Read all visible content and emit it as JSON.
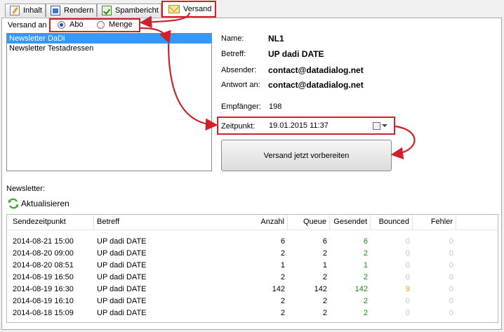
{
  "tabs": [
    {
      "label": "Inhalt",
      "icon": "edit-document-icon"
    },
    {
      "label": "Rendern",
      "icon": "render-window-icon"
    },
    {
      "label": "Spambericht",
      "icon": "spam-report-check-icon"
    },
    {
      "label": "Versand",
      "icon": "envelope-icon",
      "active": true
    }
  ],
  "versand_an": {
    "label": "Versand an",
    "options": [
      {
        "label": "Abo",
        "selected": true
      },
      {
        "label": "Menge",
        "selected": false
      }
    ]
  },
  "newsletter_list": [
    {
      "label": "Newsletter DaDi",
      "selected": true
    },
    {
      "label": "Newsletter Testadressen",
      "selected": false
    }
  ],
  "details": {
    "name_label": "Name:",
    "name_value": "NL1",
    "betreff_label": "Betreff:",
    "betreff_value": "UP dadi DATE",
    "absender_label": "Absender:",
    "absender_value": "contact@datadialog.net",
    "antwort_label": "Antwort an:",
    "antwort_value": "contact@datadialog.net",
    "empfaenger_label": "Empfänger:",
    "empfaenger_value": "198",
    "zeitpunkt_label": "Zeitpunkt:",
    "zeitpunkt_value": "19.01.2015 11:37"
  },
  "prepare_button": "Versand jetzt vorbereiten",
  "newsletter_section_label": "Newsletter:",
  "refresh_label": "Aktualisieren",
  "grid": {
    "columns": [
      "Sendezeitpunkt",
      "Betreff",
      "Anzahl",
      "Queue",
      "Gesendet",
      "Bounced",
      "Fehler"
    ],
    "rows": [
      {
        "time": "2014-08-21 15:00",
        "betreff": "UP dadi DATE",
        "anzahl": "6",
        "queue": "6",
        "gesendet": "6",
        "bounced": "0",
        "fehler": "0"
      },
      {
        "time": "2014-08-20 09:00",
        "betreff": "UP dadi DATE",
        "anzahl": "2",
        "queue": "2",
        "gesendet": "2",
        "bounced": "0",
        "fehler": "0"
      },
      {
        "time": "2014-08-20 08:51",
        "betreff": "UP dadi DATE",
        "anzahl": "1",
        "queue": "1",
        "gesendet": "1",
        "bounced": "0",
        "fehler": "0"
      },
      {
        "time": "2014-08-19 16:50",
        "betreff": "UP dadi DATE",
        "anzahl": "2",
        "queue": "2",
        "gesendet": "2",
        "bounced": "0",
        "fehler": "0"
      },
      {
        "time": "2014-08-19 16:30",
        "betreff": "UP dadi DATE",
        "anzahl": "142",
        "queue": "142",
        "gesendet": "142",
        "bounced": "9",
        "fehler": "0"
      },
      {
        "time": "2014-08-19 16:10",
        "betreff": "UP dadi DATE",
        "anzahl": "2",
        "queue": "2",
        "gesendet": "2",
        "bounced": "0",
        "fehler": "0"
      },
      {
        "time": "2014-08-18 15:09",
        "betreff": "UP dadi DATE",
        "anzahl": "2",
        "queue": "2",
        "gesendet": "2",
        "bounced": "0",
        "fehler": "0"
      }
    ]
  },
  "colors": {
    "highlight_red": "#d0202a",
    "selection_blue": "#3399ff",
    "sent_green": "#1a8a1a",
    "bounced_orange": "#f0a020",
    "zero_gray": "#c4c4c4",
    "refresh_green": "#3aa832"
  }
}
